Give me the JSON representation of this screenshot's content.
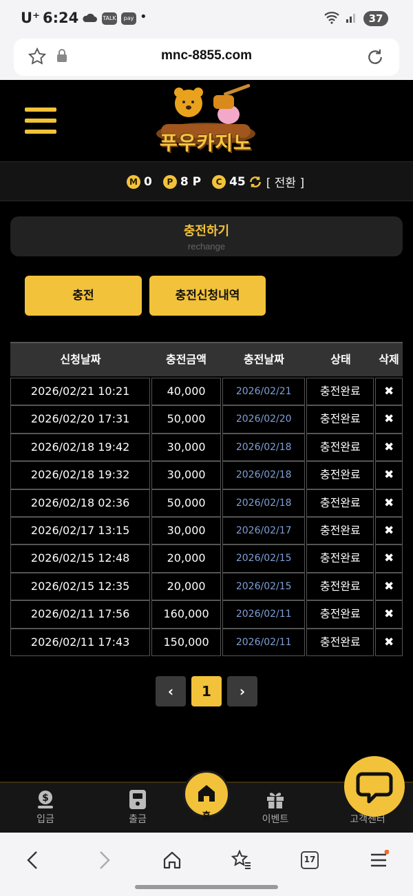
{
  "status_bar": {
    "carrier": "U⁺",
    "time": "6:24",
    "notif_icons": [
      "cloud-icon",
      "talk-icon",
      "pay-icon"
    ],
    "talk_label": "TALK",
    "pay_label": "pay",
    "dot": "•",
    "battery": "37"
  },
  "browser": {
    "url": "mnc-8855.com",
    "tab_count": "17"
  },
  "site": {
    "logo_text": "푸우카지노",
    "balance": {
      "m_badge": "M",
      "m_value": "0",
      "p_badge": "P",
      "p_value": "8 P",
      "c_badge": "C",
      "c_value": "45",
      "switch_label": "[ 전환 ]"
    },
    "panel": {
      "title": "충전하기",
      "subtitle": "rechange"
    },
    "buttons": {
      "charge": "충전",
      "history": "충전신청내역"
    },
    "table": {
      "headers": [
        "신청날짜",
        "충전금액",
        "충전날짜",
        "상태",
        "삭제"
      ],
      "rows": [
        {
          "request_date": "2026/02/21 10:21",
          "amount": "40,000",
          "charge_date": "2026/02/21",
          "status": "충전완료",
          "delete": "✖"
        },
        {
          "request_date": "2026/02/20 17:31",
          "amount": "50,000",
          "charge_date": "2026/02/20",
          "status": "충전완료",
          "delete": "✖"
        },
        {
          "request_date": "2026/02/18 19:42",
          "amount": "30,000",
          "charge_date": "2026/02/18",
          "status": "충전완료",
          "delete": "✖"
        },
        {
          "request_date": "2026/02/18 19:32",
          "amount": "30,000",
          "charge_date": "2026/02/18",
          "status": "충전완료",
          "delete": "✖"
        },
        {
          "request_date": "2026/02/18 02:36",
          "amount": "50,000",
          "charge_date": "2026/02/18",
          "status": "충전완료",
          "delete": "✖"
        },
        {
          "request_date": "2026/02/17 13:15",
          "amount": "30,000",
          "charge_date": "2026/02/17",
          "status": "충전완료",
          "delete": "✖"
        },
        {
          "request_date": "2026/02/15 12:48",
          "amount": "20,000",
          "charge_date": "2026/02/15",
          "status": "충전완료",
          "delete": "✖"
        },
        {
          "request_date": "2026/02/15 12:35",
          "amount": "20,000",
          "charge_date": "2026/02/15",
          "status": "충전완료",
          "delete": "✖"
        },
        {
          "request_date": "2026/02/11 17:56",
          "amount": "160,000",
          "charge_date": "2026/02/11",
          "status": "충전완료",
          "delete": "✖"
        },
        {
          "request_date": "2026/02/11 17:43",
          "amount": "150,000",
          "charge_date": "2026/02/11",
          "status": "충전완료",
          "delete": "✖"
        }
      ]
    },
    "pagination": {
      "prev": "‹",
      "current": "1",
      "next": "›"
    },
    "bottom_nav": {
      "deposit": "입금",
      "withdraw": "출금",
      "home": "홈",
      "event": "이벤트",
      "support": "고객센터"
    },
    "colors": {
      "accent": "#f2c23a",
      "background": "#000000",
      "date_link": "#7f9fd6"
    }
  }
}
